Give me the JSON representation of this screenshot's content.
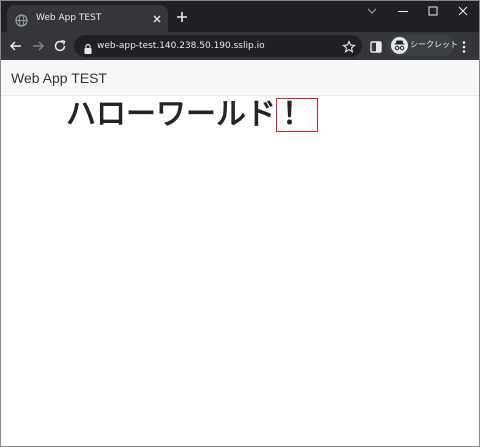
{
  "browser": {
    "tab": {
      "title": "Web App TEST"
    },
    "address_bar": {
      "url": "web-app-test.140.238.50.190.sslip.io"
    },
    "profile": {
      "label": "シークレット"
    }
  },
  "page": {
    "brand": "Web App TEST",
    "heading": {
      "text": "ハローワールド",
      "highlighted_char": "！"
    }
  },
  "colors": {
    "tabstrip_bg": "#202124",
    "toolbar_bg": "#35363a",
    "omnibox_bg": "#202124",
    "header_bg": "#f8f8f8",
    "highlight_box": "#e02020"
  },
  "icons": [
    "globe-icon",
    "close-icon",
    "plus-icon",
    "chevron-down-icon",
    "minimize-icon",
    "maximize-icon",
    "back-icon",
    "forward-icon",
    "reload-icon",
    "lock-icon",
    "star-icon",
    "side-panel-icon",
    "incognito-icon",
    "kebab-menu-icon"
  ]
}
